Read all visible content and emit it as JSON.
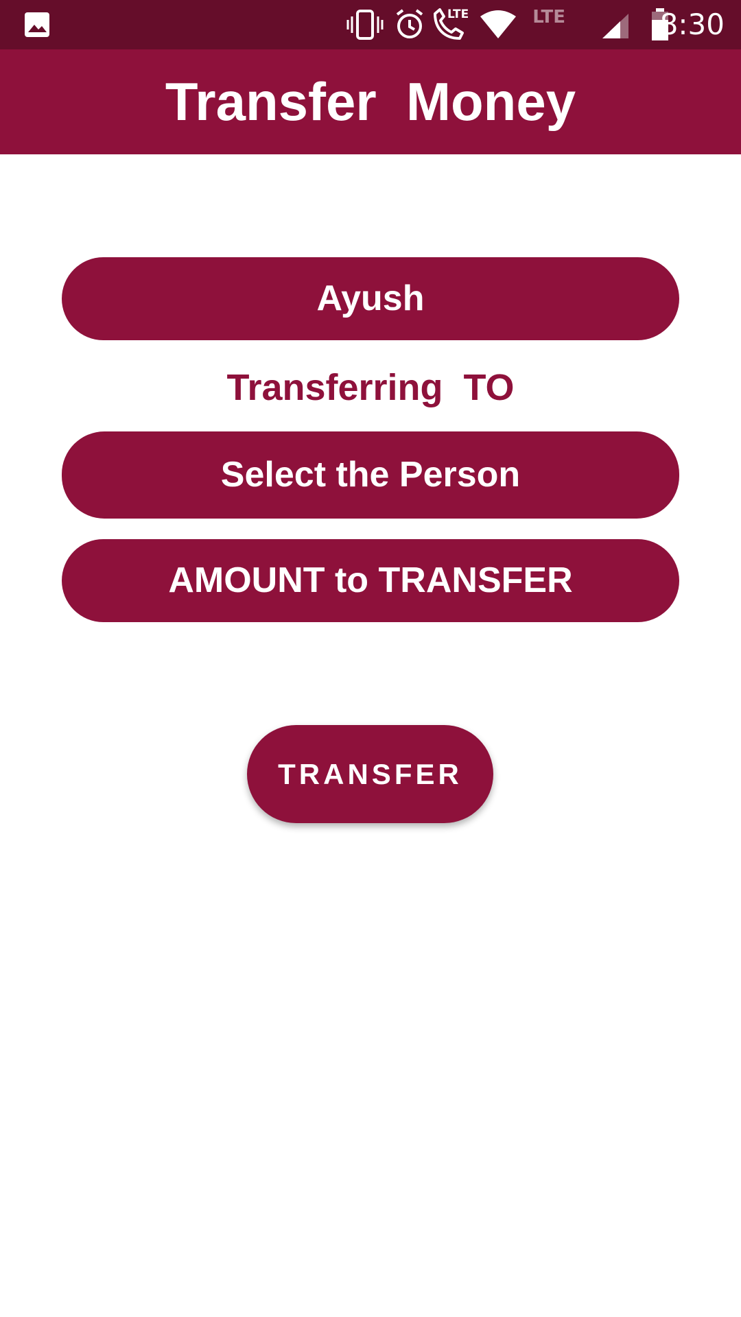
{
  "status_bar": {
    "time": "8:30",
    "network_label": "LTE",
    "call_lte_label": "LTE",
    "icons": [
      "image-icon",
      "vibrate-icon",
      "alarm-icon",
      "wifi-calling-icon",
      "wifi-icon",
      "signal-icon",
      "battery-icon"
    ]
  },
  "app_bar": {
    "title": "Transfer  Money"
  },
  "form": {
    "from_account": "Ayush",
    "to_label": "Transferring  TO",
    "select_person": "Select the Person",
    "amount_placeholder": "AMOUNT to TRANSFER"
  },
  "actions": {
    "transfer_label": "TRANSFER"
  },
  "colors": {
    "primary": "#8e113b",
    "primary_dark": "#650d2a",
    "on_primary": "#ffffff"
  }
}
